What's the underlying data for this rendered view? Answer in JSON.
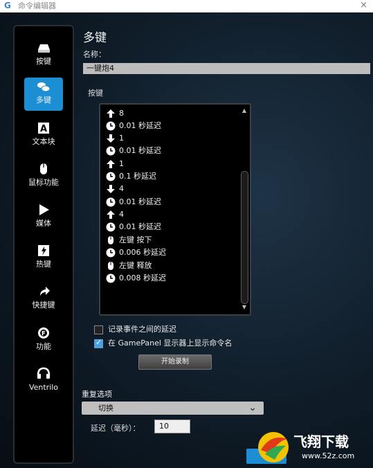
{
  "window": {
    "title": "命令编辑器",
    "close_glyph": "×"
  },
  "sidebar": {
    "items": [
      {
        "label": "按键",
        "icon": "key-icon"
      },
      {
        "label": "多键",
        "icon": "multikey-icon",
        "active": true
      },
      {
        "label": "文本块",
        "icon": "text-block-icon"
      },
      {
        "label": "鼠标功能",
        "icon": "mouse-icon"
      },
      {
        "label": "媒体",
        "icon": "play-icon"
      },
      {
        "label": "热键",
        "icon": "hotkey-icon"
      },
      {
        "label": "快捷键",
        "icon": "shortcut-arrow-icon"
      },
      {
        "label": "功能",
        "icon": "function-gear-icon"
      },
      {
        "label": "Ventrilo",
        "icon": "headset-icon"
      }
    ]
  },
  "main": {
    "heading": "多键",
    "name_label": "名称：",
    "name_value": "一键炮4",
    "keys_label": "按键",
    "steps": [
      {
        "icon": "arrow-up-icon",
        "text": "8"
      },
      {
        "icon": "clock-icon",
        "text": "0.01 秒延迟"
      },
      {
        "icon": "arrow-down-icon",
        "text": "1"
      },
      {
        "icon": "clock-icon",
        "text": "0.01 秒延迟"
      },
      {
        "icon": "arrow-up-icon",
        "text": "1"
      },
      {
        "icon": "clock-icon",
        "text": "0.1 秒延迟"
      },
      {
        "icon": "arrow-down-icon",
        "text": "4"
      },
      {
        "icon": "clock-icon",
        "text": "0.01 秒延迟"
      },
      {
        "icon": "arrow-up-icon",
        "text": "4"
      },
      {
        "icon": "clock-icon",
        "text": "0.01 秒延迟"
      },
      {
        "icon": "mouse-icon",
        "text": "左键 按下"
      },
      {
        "icon": "clock-icon",
        "text": "0.006 秒延迟"
      },
      {
        "icon": "mouse-icon",
        "text": "左键 释放"
      },
      {
        "icon": "clock-icon",
        "text": "0.008 秒延迟"
      }
    ],
    "record_delay_label": "记录事件之间的延迟",
    "record_delay_checked": false,
    "show_gamepanel_label": "在 GamePanel 显示器上显示命令名",
    "show_gamepanel_checked": true,
    "start_record_label": "开始录制",
    "repeat_label": "重复选项",
    "repeat_value": "切换",
    "delay_label": "延迟（毫秒）：",
    "delay_value": "10"
  },
  "watermark": {
    "brand": "飞翔下载",
    "url": "www.52z.com"
  },
  "colors": {
    "accent": "#1b8ed4",
    "background": "#0f1c28",
    "panel": "#000000"
  }
}
